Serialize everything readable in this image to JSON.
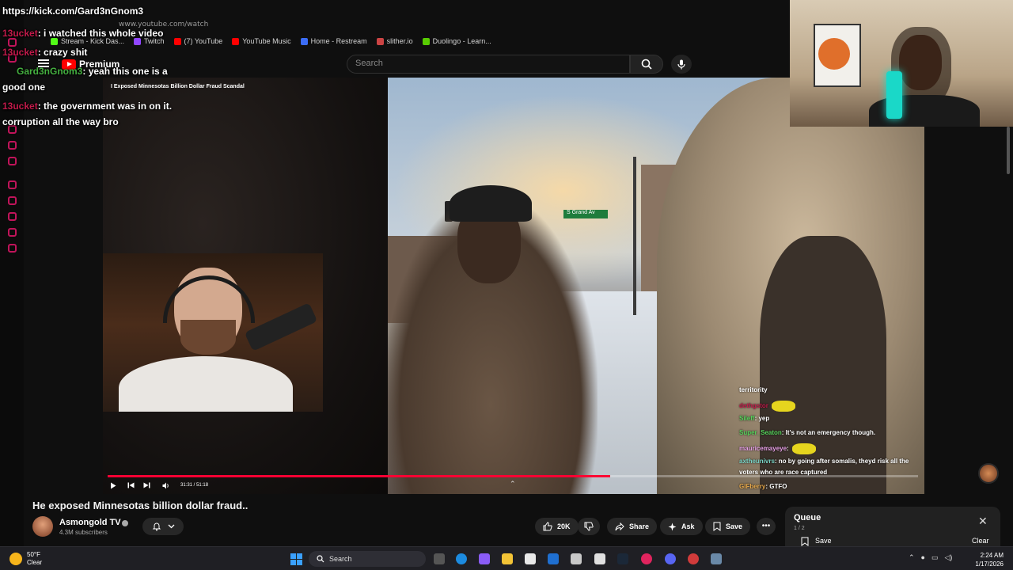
{
  "browser": {
    "url": "www.youtube.com/watch",
    "bookmarks": [
      {
        "label": "Stream - Kick Das...",
        "color": "#53fc18"
      },
      {
        "label": "Twitch",
        "color": "#9146ff"
      },
      {
        "label": "(7) YouTube",
        "color": "#ff0000"
      },
      {
        "label": "YouTube Music",
        "color": "#ff0000"
      },
      {
        "label": "Home - Restream",
        "color": "#3b6cf5"
      },
      {
        "label": "slither.io",
        "color": "#cc4444"
      },
      {
        "label": "Duolingo - Learn...",
        "color": "#58cc02"
      }
    ]
  },
  "youtube": {
    "logo_text": "Premium",
    "search_placeholder": "Search"
  },
  "chat_overlay": {
    "lines": [
      {
        "user": "",
        "text": "https://kick.com/Gard3nGnom3"
      },
      {
        "user": "13ucket",
        "text": ": i watched this whole video"
      },
      {
        "user": "13ucket",
        "text": ": crazy shit"
      },
      {
        "user": "Gard3nGnom3",
        "text": ": yeah this one is a"
      },
      {
        "user": "",
        "text": "good one"
      },
      {
        "user": "13ucket",
        "text": ": the government was in on it."
      },
      {
        "user": "",
        "text": "corruption all the way bro"
      }
    ]
  },
  "video": {
    "overlay_title": "I Exposed Minnesotas Billion Dollar Fraud Scandal",
    "street_sign": "S Grand Av",
    "time_display": "31:31 / 51:18",
    "progress": 0.62
  },
  "video_chat": [
    {
      "user": "territority",
      "text": "",
      "color": "#ffffff"
    },
    {
      "user": "dethgstor",
      "text": "",
      "color": "#c21a4a",
      "emote": true
    },
    {
      "user": "Sileff",
      "text": ": yep",
      "color": "#55d45b"
    },
    {
      "user": "Super_Seaton",
      "text": ": It's not an emergency though.",
      "color": "#55d45b"
    },
    {
      "user": "mauricemayeye",
      "text": ":",
      "color": "#e8a0e8",
      "emote": true
    },
    {
      "user": "axtheunivrs",
      "text": ": no by going after somalis, theyd risk all the",
      "color": "#7bd6c8"
    },
    {
      "user": "",
      "text": "voters who are race captured",
      "color": "#ffffff"
    },
    {
      "user": "GIFberry",
      "text": ": GTFO",
      "color": "#e6a84b"
    }
  ],
  "details": {
    "title": "He exposed Minnesotas billion dollar fraud..",
    "channel": "Asmongold TV",
    "subscribers": "4.3M subscribers",
    "likes": "20K",
    "share": "Share",
    "ask": "Ask",
    "save": "Save"
  },
  "queue": {
    "title": "Queue",
    "count": "1 / 2",
    "save": "Save",
    "clear": "Clear"
  },
  "taskbar": {
    "temp": "50°F",
    "condition": "Clear",
    "search": "Search",
    "time": "2:24 AM",
    "date": "1/17/2026"
  },
  "colors": {
    "accent_red": "#ff0033",
    "rail_pink": "#c0145a"
  }
}
